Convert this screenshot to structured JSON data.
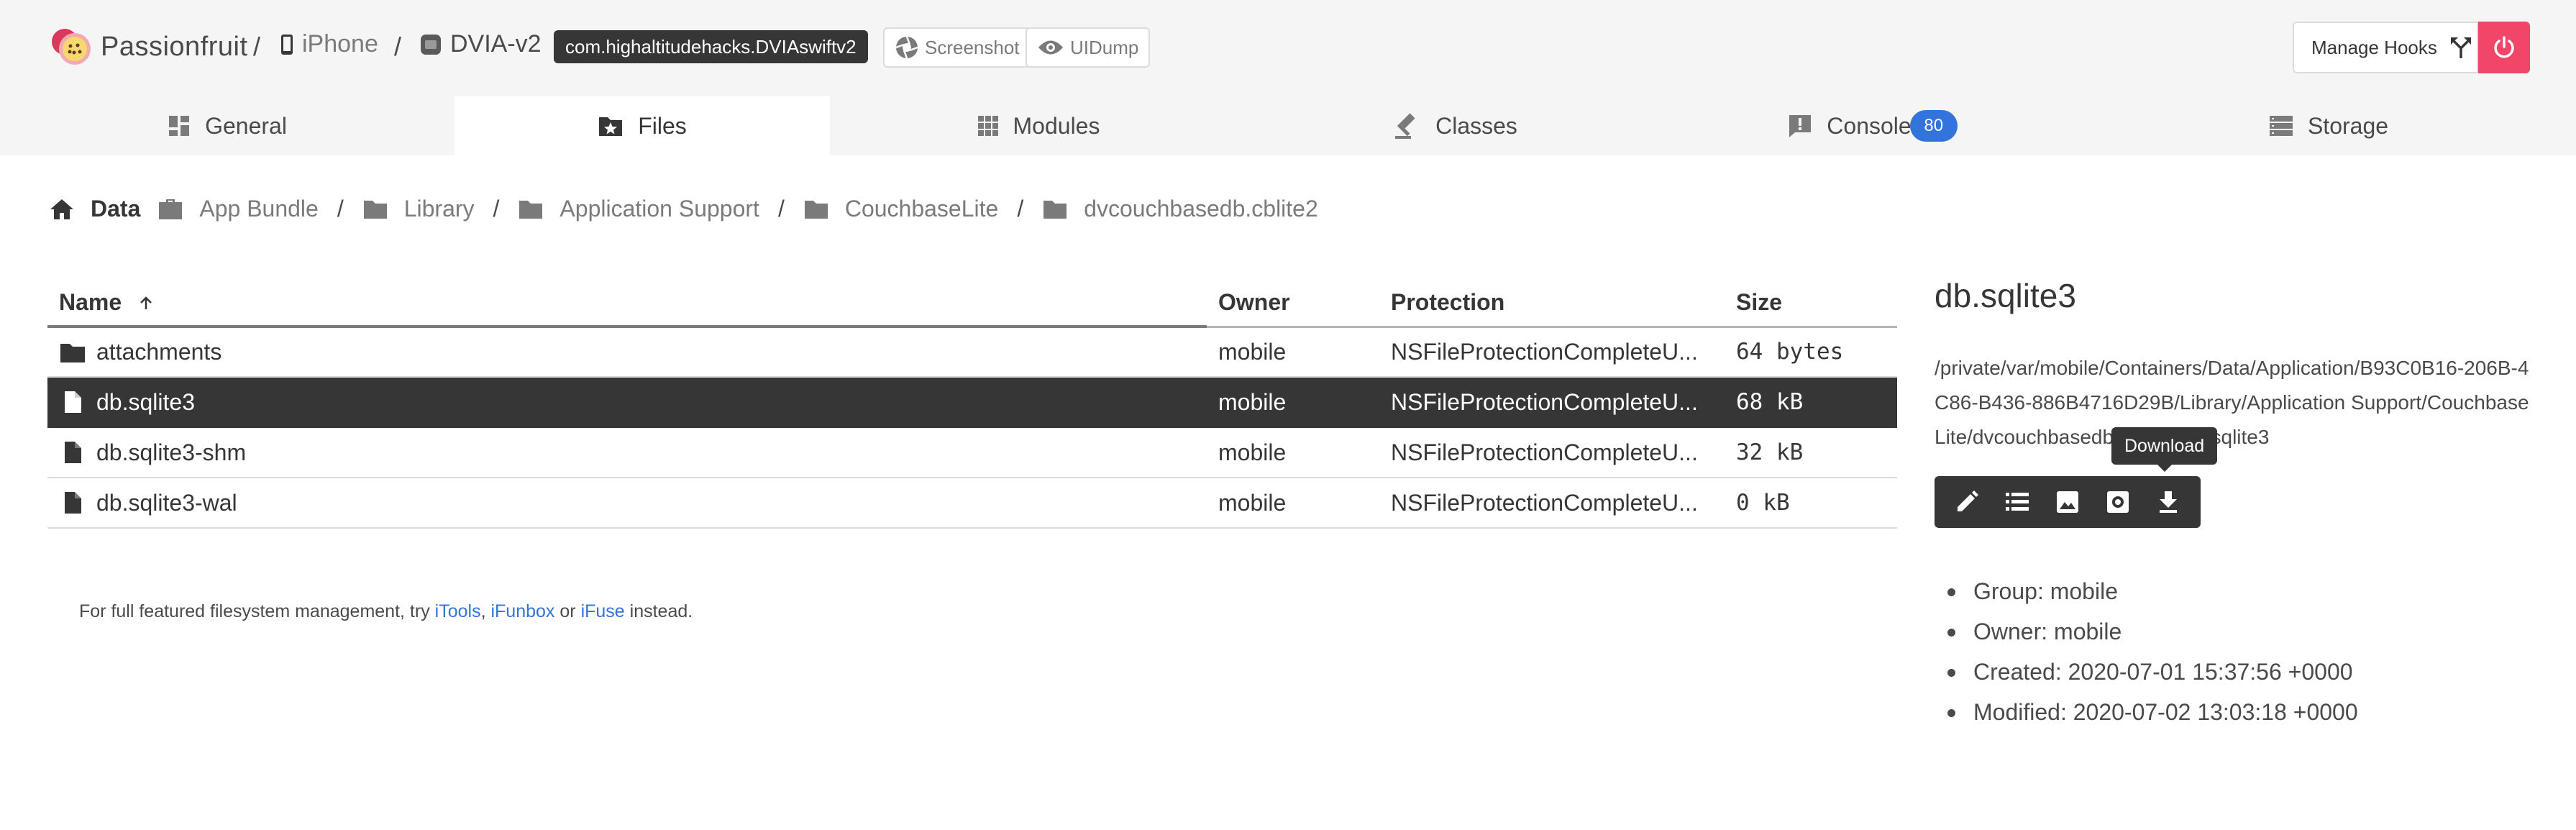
{
  "app": {
    "name": "Passionfruit"
  },
  "header": {
    "device_name": "iPhone",
    "app_name": "DVIA-v2",
    "bundle_id": "com.highaltitudehacks.DVIAswiftv2",
    "screenshot_label": "Screenshot",
    "uidump_label": "UIDump",
    "manage_hooks_label": "Manage Hooks",
    "separator": "/"
  },
  "tabs": [
    {
      "label": "General",
      "icon": "dashboard-icon",
      "active": false
    },
    {
      "label": "Files",
      "icon": "folder-star-icon",
      "active": true
    },
    {
      "label": "Modules",
      "icon": "grid-icon",
      "active": false
    },
    {
      "label": "Classes",
      "icon": "gavel-icon",
      "active": false
    },
    {
      "label": "Console",
      "icon": "alert-box-icon",
      "active": false,
      "badge": "80"
    },
    {
      "label": "Storage",
      "icon": "database-icon",
      "active": false
    }
  ],
  "breadcrumb": {
    "root": "Data",
    "items": [
      "App Bundle",
      "Library",
      "Application Support",
      "CouchbaseLite",
      "dvcouchbasedb.cblite2"
    ],
    "separator": "/"
  },
  "files_table": {
    "columns": [
      "Name",
      "Owner",
      "Protection",
      "Size"
    ],
    "sort_column": "Name",
    "sort_dir": "asc",
    "rows": [
      {
        "name": "attachments",
        "type": "folder",
        "owner": "mobile",
        "protection": "NSFileProtectionCompleteU...",
        "size": "64 bytes",
        "selected": false
      },
      {
        "name": "db.sqlite3",
        "type": "file",
        "owner": "mobile",
        "protection": "NSFileProtectionCompleteU...",
        "size": "68 kB",
        "selected": true
      },
      {
        "name": "db.sqlite3-shm",
        "type": "file",
        "owner": "mobile",
        "protection": "NSFileProtectionCompleteU...",
        "size": "32 kB",
        "selected": false
      },
      {
        "name": "db.sqlite3-wal",
        "type": "file",
        "owner": "mobile",
        "protection": "NSFileProtectionCompleteU...",
        "size": "0 kB",
        "selected": false
      }
    ]
  },
  "hint": {
    "prefix": "For full featured filesystem management, try ",
    "link1": "iTools",
    "sep1": ", ",
    "link2": "iFunbox",
    "sep2": " or ",
    "link3": "iFuse",
    "suffix": " instead."
  },
  "detail": {
    "title": "db.sqlite3",
    "path": "/private/var/mobile/Containers/Data/Application/B93C0B16-206B-4C86-B436-886B4716D29B/Library/Application Support/CouchbaseLite/dvcouchbasedb.cblite2/db.sqlite3",
    "tooltip": "Download",
    "actions": [
      "edit-icon",
      "list-icon",
      "image-icon",
      "settings-box-icon",
      "download-icon"
    ],
    "props": [
      "Group: mobile",
      "Owner: mobile",
      "Created: 2020-07-01 15:37:56 +0000",
      "Modified: 2020-07-02 13:03:18 +0000"
    ]
  },
  "colors": {
    "header_bg": "#f5f5f5",
    "dark": "#363636",
    "accent_blue": "#3273dc",
    "danger": "#f14668",
    "logo_red": "#e0405e"
  }
}
